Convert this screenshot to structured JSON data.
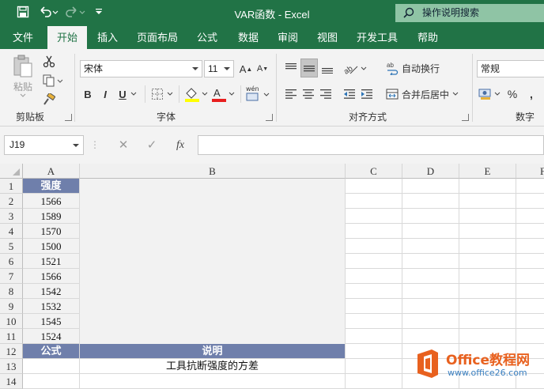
{
  "window": {
    "title": "VAR函数 - Excel",
    "tell_me": "操作说明搜索"
  },
  "tabs": [
    {
      "label": "文件",
      "active": false
    },
    {
      "label": "开始",
      "active": true
    },
    {
      "label": "插入",
      "active": false
    },
    {
      "label": "页面布局",
      "active": false
    },
    {
      "label": "公式",
      "active": false
    },
    {
      "label": "数据",
      "active": false
    },
    {
      "label": "审阅",
      "active": false
    },
    {
      "label": "视图",
      "active": false
    },
    {
      "label": "开发工具",
      "active": false
    },
    {
      "label": "帮助",
      "active": false
    }
  ],
  "ribbon": {
    "clipboard": {
      "paste_label": "粘贴",
      "group_label": "剪贴板"
    },
    "font": {
      "font_name": "宋体",
      "font_size": "11",
      "grow_label": "A",
      "shrink_label": "A",
      "bold_label": "B",
      "italic_label": "I",
      "underline_label": "U",
      "font_color_label": "A",
      "phonetic_label": "wén",
      "group_label": "字体"
    },
    "alignment": {
      "wrap_label": "自动换行",
      "merge_label": "合并后居中",
      "group_label": "对齐方式"
    },
    "number": {
      "format": "常规",
      "percent_label": "%",
      "comma_label": ",",
      "group_label": "数字"
    }
  },
  "formula_bar": {
    "name_box": "J19",
    "fx_label": "fx",
    "cancel_label": "✕",
    "enter_label": "✓",
    "formula": ""
  },
  "grid": {
    "columns": [
      "A",
      "B",
      "C",
      "D",
      "E",
      "F"
    ],
    "rows": [
      "1",
      "2",
      "3",
      "4",
      "5",
      "6",
      "7",
      "8",
      "9",
      "10",
      "11",
      "12",
      "13",
      "14"
    ],
    "header_a1": "强度",
    "values": [
      "1566",
      "1589",
      "1570",
      "1500",
      "1521",
      "1566",
      "1542",
      "1532",
      "1545",
      "1524"
    ],
    "formula_header": "公式",
    "desc_header": "说明",
    "description": "工具抗断强度的方差",
    "header_color": "#6f7fab"
  },
  "watermark": {
    "title": "Office教程网",
    "url": "www.office26.com",
    "logo_color": "#e8611f"
  }
}
